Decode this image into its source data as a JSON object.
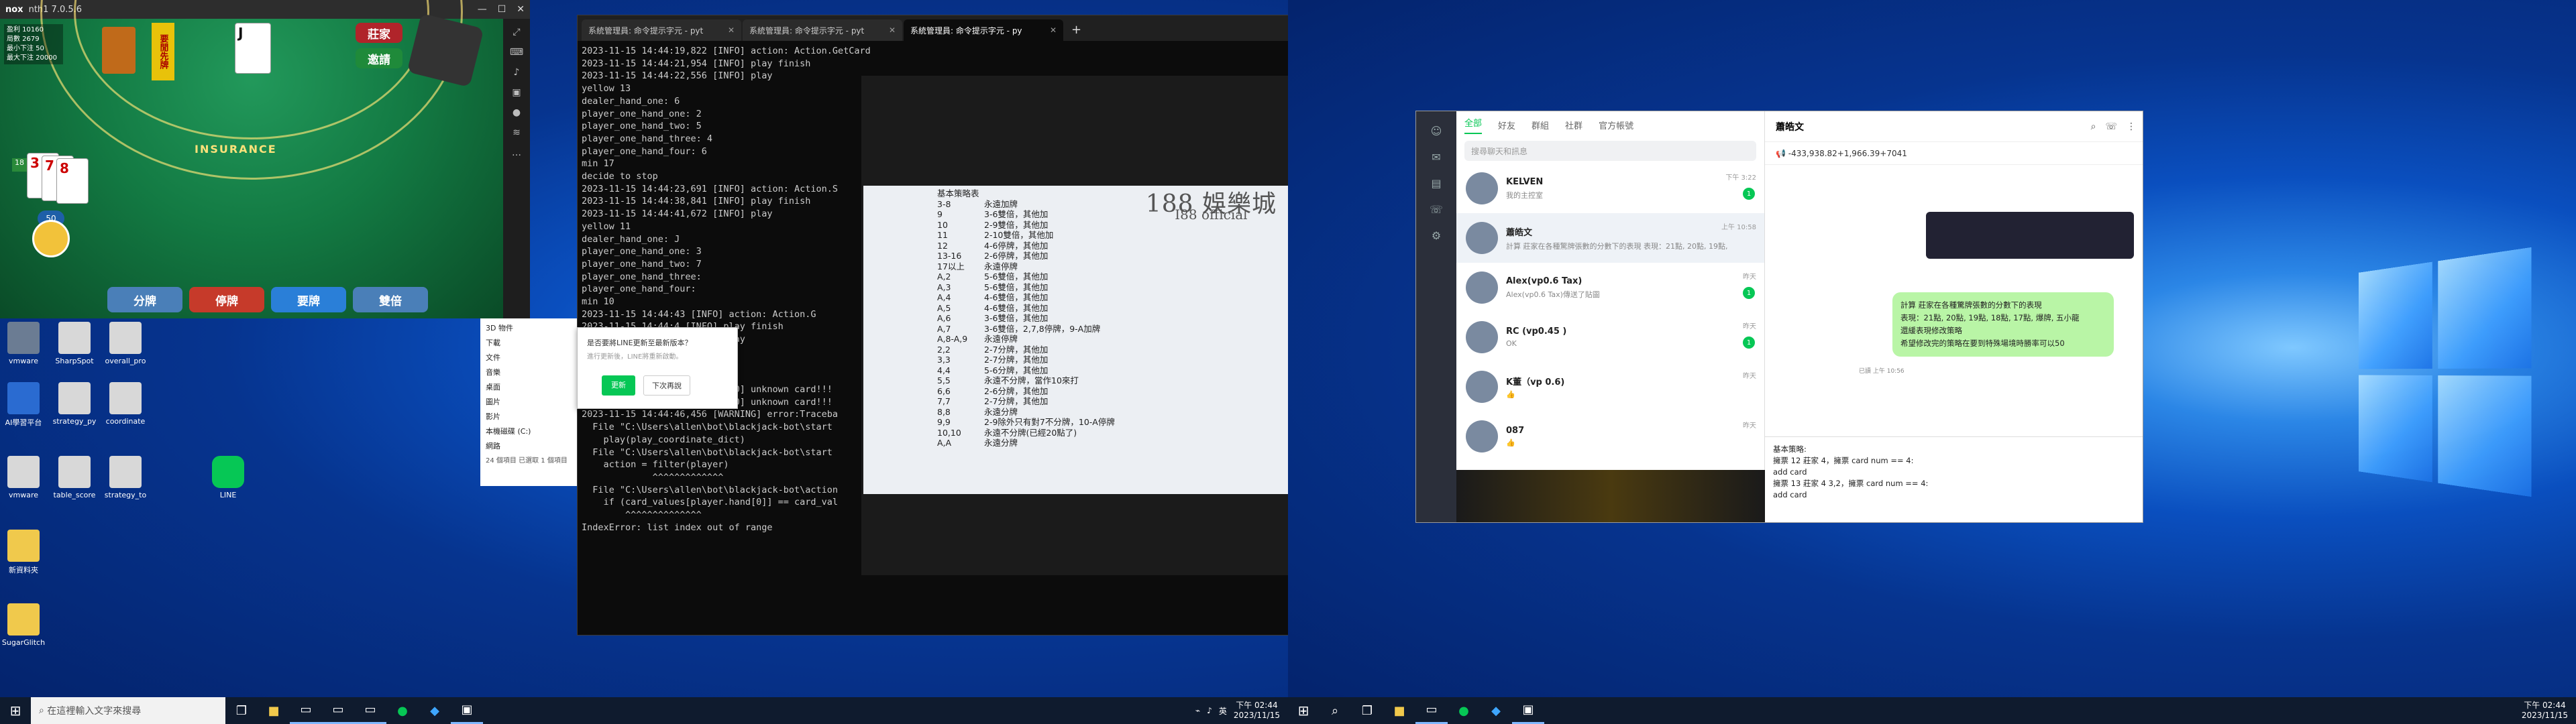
{
  "game": {
    "app_title": "nth1 7.0.5.6",
    "dealer_label": "莊家",
    "invite_label": "邀請",
    "stats": [
      "盈利 10160",
      "局數 2679",
      "最小下注 50",
      "最大下注 20000"
    ],
    "first_label": "要閒先牌",
    "insurance": "INSURANCE",
    "cards": [
      "3",
      "7",
      "8"
    ],
    "score": "18",
    "bet": "50",
    "split": "分牌",
    "stand": "停牌",
    "hit": "要牌",
    "double": "雙倍"
  },
  "terminal": {
    "tabs": [
      "系統管理員: 命令提示字元 - pyt",
      "系統管理員: 命令提示字元 - pyt",
      "系統管理員: 命令提示字元 - py"
    ],
    "lines": [
      "2023-11-15 14:44:19,822 [INFO] action: Action.GetCard",
      "2023-11-15 14:44:21,954 [INFO] play finish",
      "2023-11-15 14:44:22,556 [INFO] play",
      "yellow 13",
      "dealer_hand_one: 6",
      "player_one_hand_one: 2",
      "player_one_hand_two: 5",
      "player_one_hand_three: 4",
      "player_one_hand_four: 6",
      "min 17",
      "decide to stop",
      "2023-11-15 14:44:23,691 [INFO] action: Action.S",
      "2023-11-15 14:44:38,841 [INFO] play finish",
      "2023-11-15 14:44:41,672 [INFO] play",
      "yellow 11",
      "dealer_hand_one: J",
      "player_one_hand_one: 3",
      "player_one_hand_two: 7",
      "player_one_hand_three:",
      "player_one_hand_four:",
      "min 10",
      "",
      "",
      "2023-11-15 14:44:43 [INFO] action: Action.G",
      "2023-11-15 14:44:4 [INFO] play finish",
      "2023-11-15 14:44:4 [INFO] play",
      "",
      "",
      "",
      "player_one_hand_two: a",
      "player_one_hand_three:",
      "player_one_hand_four:",
      "2023-11-15 14:44:46,456 [INFO] unknown card!!!",
      "2023-11-15 14:44:46,456 [INFO] unknown card!!!",
      "2023-11-15 14:44:46,456 [WARNING] error:Traceba",
      "  File \"C:\\Users\\allen\\bot\\blackjack-bot\\start",
      "    play(play_coordinate_dict)",
      "  File \"C:\\Users\\allen\\bot\\blackjack-bot\\start",
      "    action = filter(player)",
      "             ^^^^^^^^^^^^^",
      "  File \"C:\\Users\\allen\\bot\\blackjack-bot\\action",
      "    if (card_values[player.hand[0]] == card_val",
      "        ^^^^^^^^^^^^^^",
      "",
      "IndexError: list index out of range"
    ]
  },
  "strategy": {
    "title": "基本策略表",
    "rows": [
      [
        "3-8",
        "永遠加牌"
      ],
      [
        "9",
        "3-6雙倍，其他加"
      ],
      [
        "10",
        "2-9雙倍，其他加"
      ],
      [
        "11",
        "2-10雙倍，其他加"
      ],
      [
        "12",
        "4-6停牌，其他加"
      ],
      [
        "13-16",
        "2-6停牌，其他加"
      ],
      [
        "17以上",
        "永遠停牌"
      ],
      [
        "A,2",
        "5-6雙倍，其他加"
      ],
      [
        "A,3",
        "5-6雙倍，其他加"
      ],
      [
        "A,4",
        "4-6雙倍，其他加"
      ],
      [
        "A,5",
        "4-6雙倍，其他加"
      ],
      [
        "A,6",
        "3-6雙倍，其他加"
      ],
      [
        "A,7",
        "3-6雙倍，2,7,8停牌，9-A加牌"
      ],
      [
        "A,8-A,9",
        "永遠停牌"
      ],
      [
        "2,2",
        "2-7分牌，其他加"
      ],
      [
        "3,3",
        "2-7分牌，其他加"
      ],
      [
        "4,4",
        "5-6分牌，其他加"
      ],
      [
        "5,5",
        "永遠不分牌，當作10來打"
      ],
      [
        "6,6",
        "2-6分牌，其他加"
      ],
      [
        "7,7",
        "2-7分牌，其他加"
      ],
      [
        "8,8",
        "永遠分牌"
      ],
      [
        "9,9",
        "2-9除外只有對7不分牌，10-A停牌"
      ],
      [
        "10,10",
        "永遠不分牌(已經20點了)"
      ],
      [
        "A,A",
        "永遠分牌"
      ]
    ],
    "logo_a": "188 娛樂城",
    "logo_b": "I88 official"
  },
  "dialog": {
    "text": "是否要將LINE更新至最新版本？",
    "sub": "進行更新後，LINE將重新啟動。",
    "update": "更新",
    "later": "下次再說"
  },
  "explorer": {
    "items": [
      "3D 物件",
      "下載",
      "文件",
      "音樂",
      "桌面",
      "圖片",
      "影片",
      "本機磁碟 (C:)",
      "網路"
    ],
    "status": "24 個項目",
    "sel": "已選取 1 個項目"
  },
  "line": {
    "filters": [
      "全部",
      "好友",
      "群組",
      "社群",
      "官方帳號"
    ],
    "search": "搜尋聊天和訊息",
    "chats": [
      {
        "name": "KELVEN",
        "snip": "我的主控室",
        "time": "下午 3:22",
        "badge": "1"
      },
      {
        "name": "蕭皓文",
        "snip": "計算 莊家在各種驚牌張數的分數下的表現 表現：21點, 20點, 19點, 18點, 17點, 爆牌, 五小龍 ...",
        "time": "上午 10:58",
        "badge": ""
      },
      {
        "name": "Alex(vp0.6 Tax)",
        "snip": "Alex(vp0.6 Tax)傳送了貼圖",
        "time": "昨天",
        "badge": "1"
      },
      {
        "name": "RC (vp0.45 )",
        "snip": "OK",
        "time": "昨天",
        "badge": "1"
      },
      {
        "name": "K董（vp 0.6)",
        "snip": "👍",
        "time": "昨天",
        "badge": ""
      },
      {
        "name": "087",
        "snip": "👍",
        "time": "昨天",
        "badge": ""
      }
    ],
    "chat_name": "蕭皓文",
    "announce": "-433,938.82+1,966.39+7041",
    "bubble": "計算 莊家在各種驚牌張數的分數下的表現\n表現：21點, 20點, 19點, 18點, 17點, 爆牌, 五小龍\n還緩表現修改策略\n希望修改完的策略在要到特殊場境時勝率可以50",
    "read": "已讀 上午 10:56",
    "input": "基本策略:\n擁票 12 莊家 4，擁票 card num == 4:\nadd card\n擁票 13 莊家 4 3,2，擁票 card num == 4:\nadd card"
  },
  "taskbar": {
    "search": "在這裡輸入文字來搜尋",
    "time": "下午 02:44",
    "date": "2023/11/15",
    "ime": "英"
  },
  "desktop_icons": [
    "vmware",
    "SharpSpot",
    "overall_pro",
    "AI學習平台",
    "strategy_py",
    "coordinate",
    "vmware",
    "table_score",
    "strategy_to",
    "LINE",
    "新資料夾",
    "SugarGlitch"
  ]
}
